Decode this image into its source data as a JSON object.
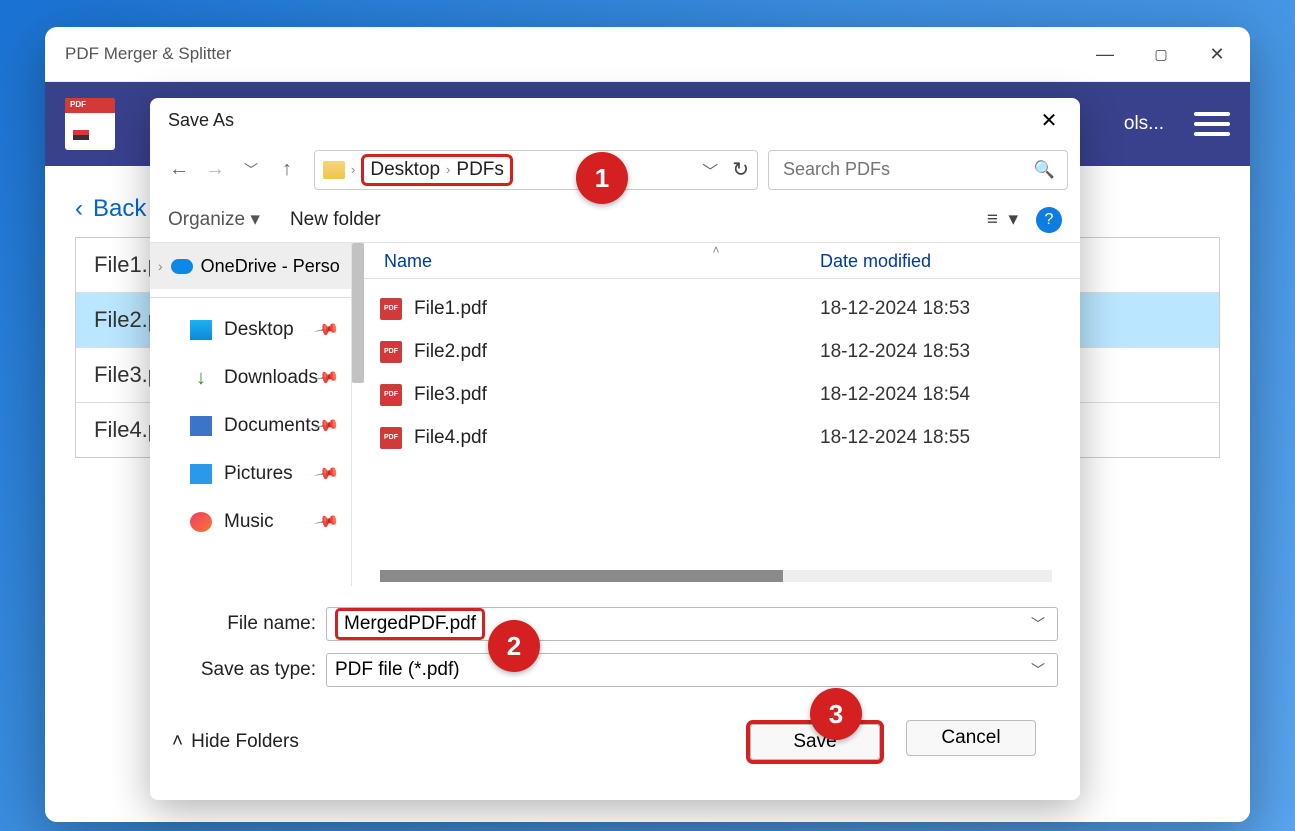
{
  "outer": {
    "title": "PDF Merger & Splitter"
  },
  "toolbar": {
    "tools_label": "ols..."
  },
  "back_link": "Back",
  "bg_files": [
    {
      "label": "File1.p"
    },
    {
      "label": "File2.p"
    },
    {
      "label": "File3.p"
    },
    {
      "label": "File4.p"
    }
  ],
  "dialog": {
    "title": "Save As",
    "breadcrumb": {
      "seg1": "Desktop",
      "seg2": "PDFs"
    },
    "search_placeholder": "Search PDFs",
    "organize": "Organize",
    "new_folder": "New folder",
    "help": "?",
    "sidebar": {
      "onedrive": "OneDrive - Perso",
      "items": [
        {
          "label": "Desktop"
        },
        {
          "label": "Downloads"
        },
        {
          "label": "Documents"
        },
        {
          "label": "Pictures"
        },
        {
          "label": "Music"
        }
      ]
    },
    "columns": {
      "name": "Name",
      "date": "Date modified"
    },
    "files": [
      {
        "name": "File1.pdf",
        "date": "18-12-2024 18:53"
      },
      {
        "name": "File2.pdf",
        "date": "18-12-2024 18:53"
      },
      {
        "name": "File3.pdf",
        "date": "18-12-2024 18:54"
      },
      {
        "name": "File4.pdf",
        "date": "18-12-2024 18:55"
      }
    ],
    "file_name_label": "File name:",
    "file_name_value": "MergedPDF.pdf",
    "save_type_label": "Save as type:",
    "save_type_value": "PDF file (*.pdf)",
    "hide_folders": "Hide Folders",
    "save_btn": "Save",
    "cancel_btn": "Cancel"
  },
  "annotations": [
    "1",
    "2",
    "3"
  ]
}
